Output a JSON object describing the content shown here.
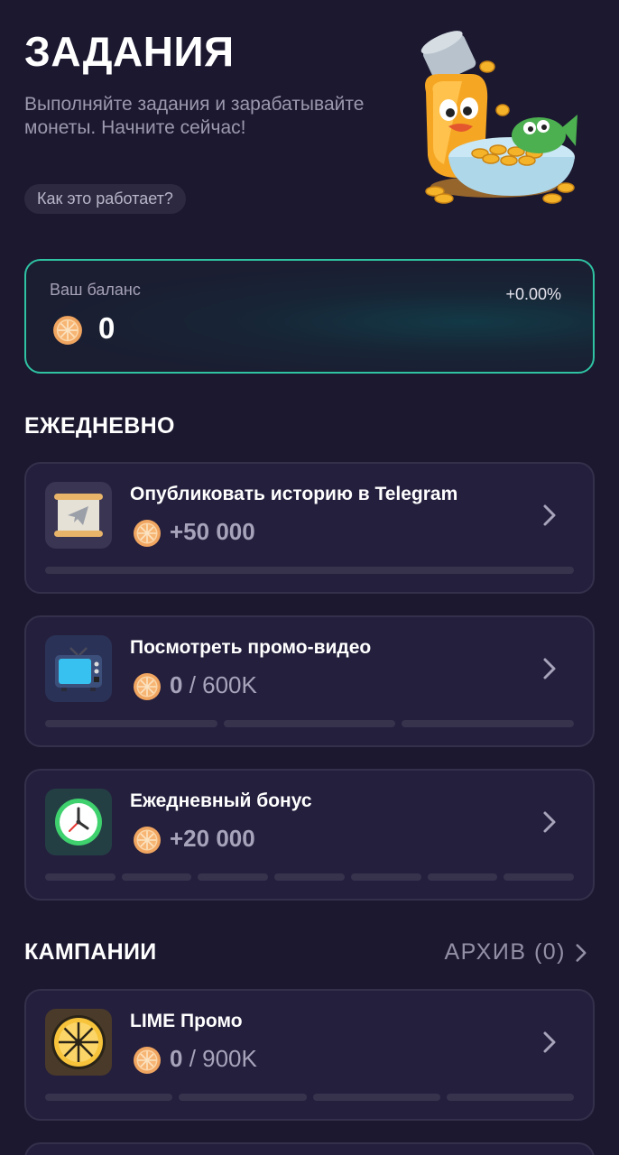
{
  "header": {
    "title": "ЗАДАНИЯ",
    "subtitle": "Выполняйте задания и зарабатывайте монеты. Начните сейчас!",
    "how_it_works": "Как это работает?"
  },
  "balance": {
    "label": "Ваш баланс",
    "value": "0",
    "change": "+0.00%"
  },
  "daily": {
    "title": "ЕЖЕДНЕВНО",
    "tasks": [
      {
        "title": "Опубликовать историю в Telegram",
        "reward": "+50 000",
        "total": "",
        "progress_segments": 1,
        "icon": "telegram-scroll-icon"
      },
      {
        "title": "Посмотреть промо-видео",
        "reward": "0",
        "total": " / 600K",
        "progress_segments": 3,
        "icon": "tv-icon"
      },
      {
        "title": "Ежедневный бонус",
        "reward": "+20 000",
        "total": "",
        "progress_segments": 7,
        "icon": "clock-icon"
      }
    ]
  },
  "campaigns": {
    "title": "КАМПАНИИ",
    "archive": "АРХИВ (0)",
    "tasks": [
      {
        "title": "LIME Промо",
        "reward": "0",
        "total": " / 900K",
        "progress_segments": 4,
        "icon": "lime-icon"
      }
    ]
  },
  "colors": {
    "background": "#1b1830",
    "card": "#241f3d",
    "accent_border": "#2fc3a2",
    "coin": "#f2a35a"
  }
}
